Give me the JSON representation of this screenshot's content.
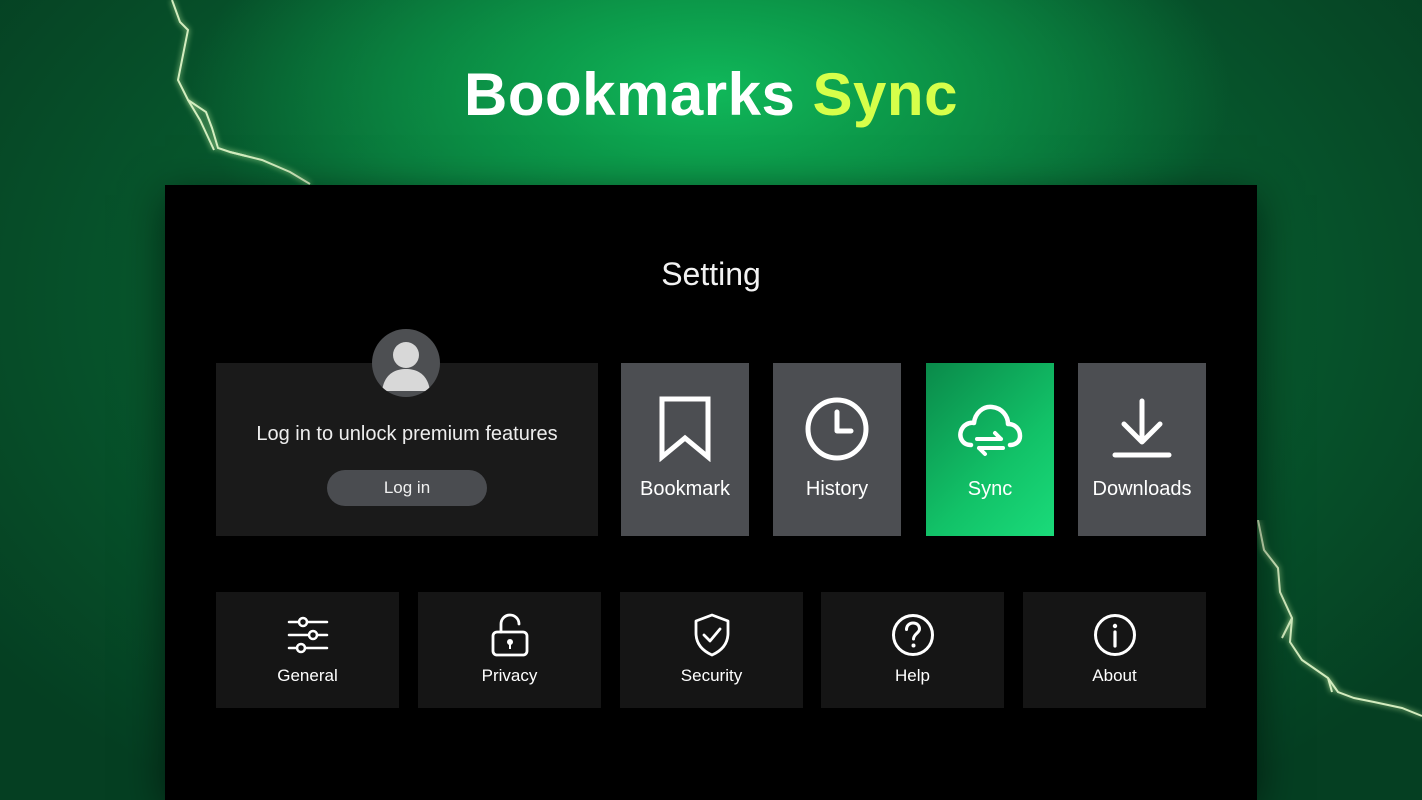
{
  "headline": {
    "part1": "Bookmarks",
    "part2": "Sync",
    "accent_color": "#d6ff4a"
  },
  "panel": {
    "title": "Setting"
  },
  "login": {
    "message": "Log in to unlock premium features",
    "button_label": "Log in",
    "avatar_icon": "user-avatar-icon"
  },
  "tiles": [
    {
      "label": "Bookmark",
      "icon": "bookmark-icon",
      "active": false
    },
    {
      "label": "History",
      "icon": "clock-icon",
      "active": false
    },
    {
      "label": "Sync",
      "icon": "cloud-sync-icon",
      "active": true
    },
    {
      "label": "Downloads",
      "icon": "download-icon",
      "active": false
    }
  ],
  "menu": [
    {
      "label": "General",
      "icon": "sliders-icon"
    },
    {
      "label": "Privacy",
      "icon": "unlock-icon"
    },
    {
      "label": "Security",
      "icon": "shield-check-icon"
    },
    {
      "label": "Help",
      "icon": "question-icon"
    },
    {
      "label": "About",
      "icon": "info-icon"
    }
  ],
  "colors": {
    "background": "#0b7a3e",
    "panel": "#000000",
    "tile": "#4c4e52",
    "active_tile": "#12c268"
  }
}
